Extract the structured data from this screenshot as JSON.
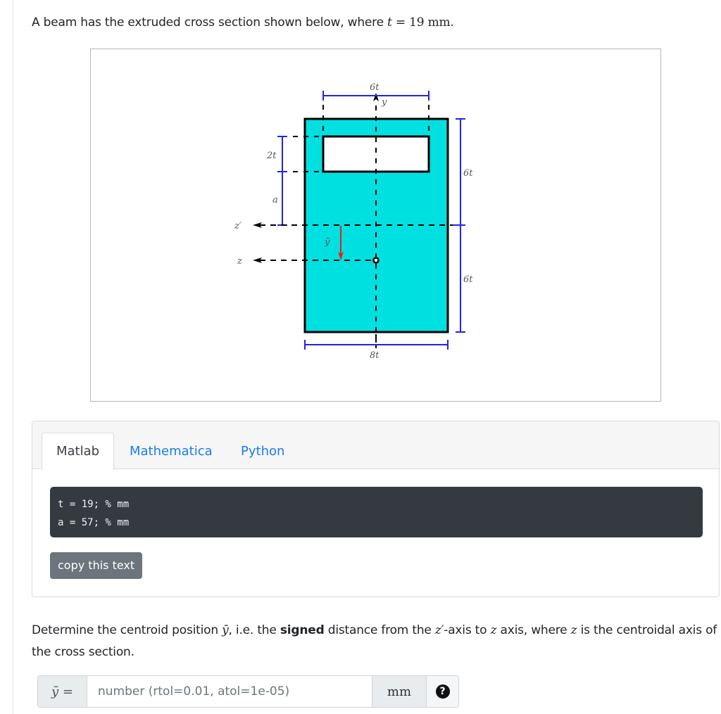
{
  "intro": {
    "text_before": "A beam has the extruded cross section shown below, where ",
    "var": "t",
    "equals": " = ",
    "value": "19",
    "unit": " mm",
    "period": "."
  },
  "figure": {
    "labels": {
      "top_width": "6t",
      "y_axis": "y",
      "hole_height": "2t",
      "a_dim": "a",
      "z_prime": "z′",
      "z": "z",
      "ybar": "ȳ",
      "right_upper": "6t",
      "right_lower": "6t",
      "bottom_width": "8t"
    },
    "colors": {
      "fill": "#00e0e0",
      "dimension": "#2222ee",
      "ybar_arrow": "#e02020",
      "outline": "#000000"
    }
  },
  "code_card": {
    "tabs": [
      {
        "label": "Matlab",
        "active": true
      },
      {
        "label": "Mathematica",
        "active": false
      },
      {
        "label": "Python",
        "active": false
      }
    ],
    "code_lines": [
      "t = 19; % mm",
      "a = 57; % mm"
    ],
    "copy_label": "copy this text"
  },
  "question": {
    "p1": "Determine the centroid position ",
    "ybar": "ȳ",
    "p2": ", i.e. the ",
    "bold": "signed",
    "p3": " distance from the ",
    "zprime": "z′",
    "p4": "-axis to ",
    "z1": "z",
    "p5": " axis, where ",
    "z2": "z",
    "p6": " is the centroidal axis of the cross section."
  },
  "answer": {
    "prefix": "ȳ =",
    "placeholder": "number (rtol=0.01, atol=1e-05)",
    "value": "",
    "unit": "mm",
    "help_icon": "question-circle-icon",
    "help_glyph": "?"
  }
}
